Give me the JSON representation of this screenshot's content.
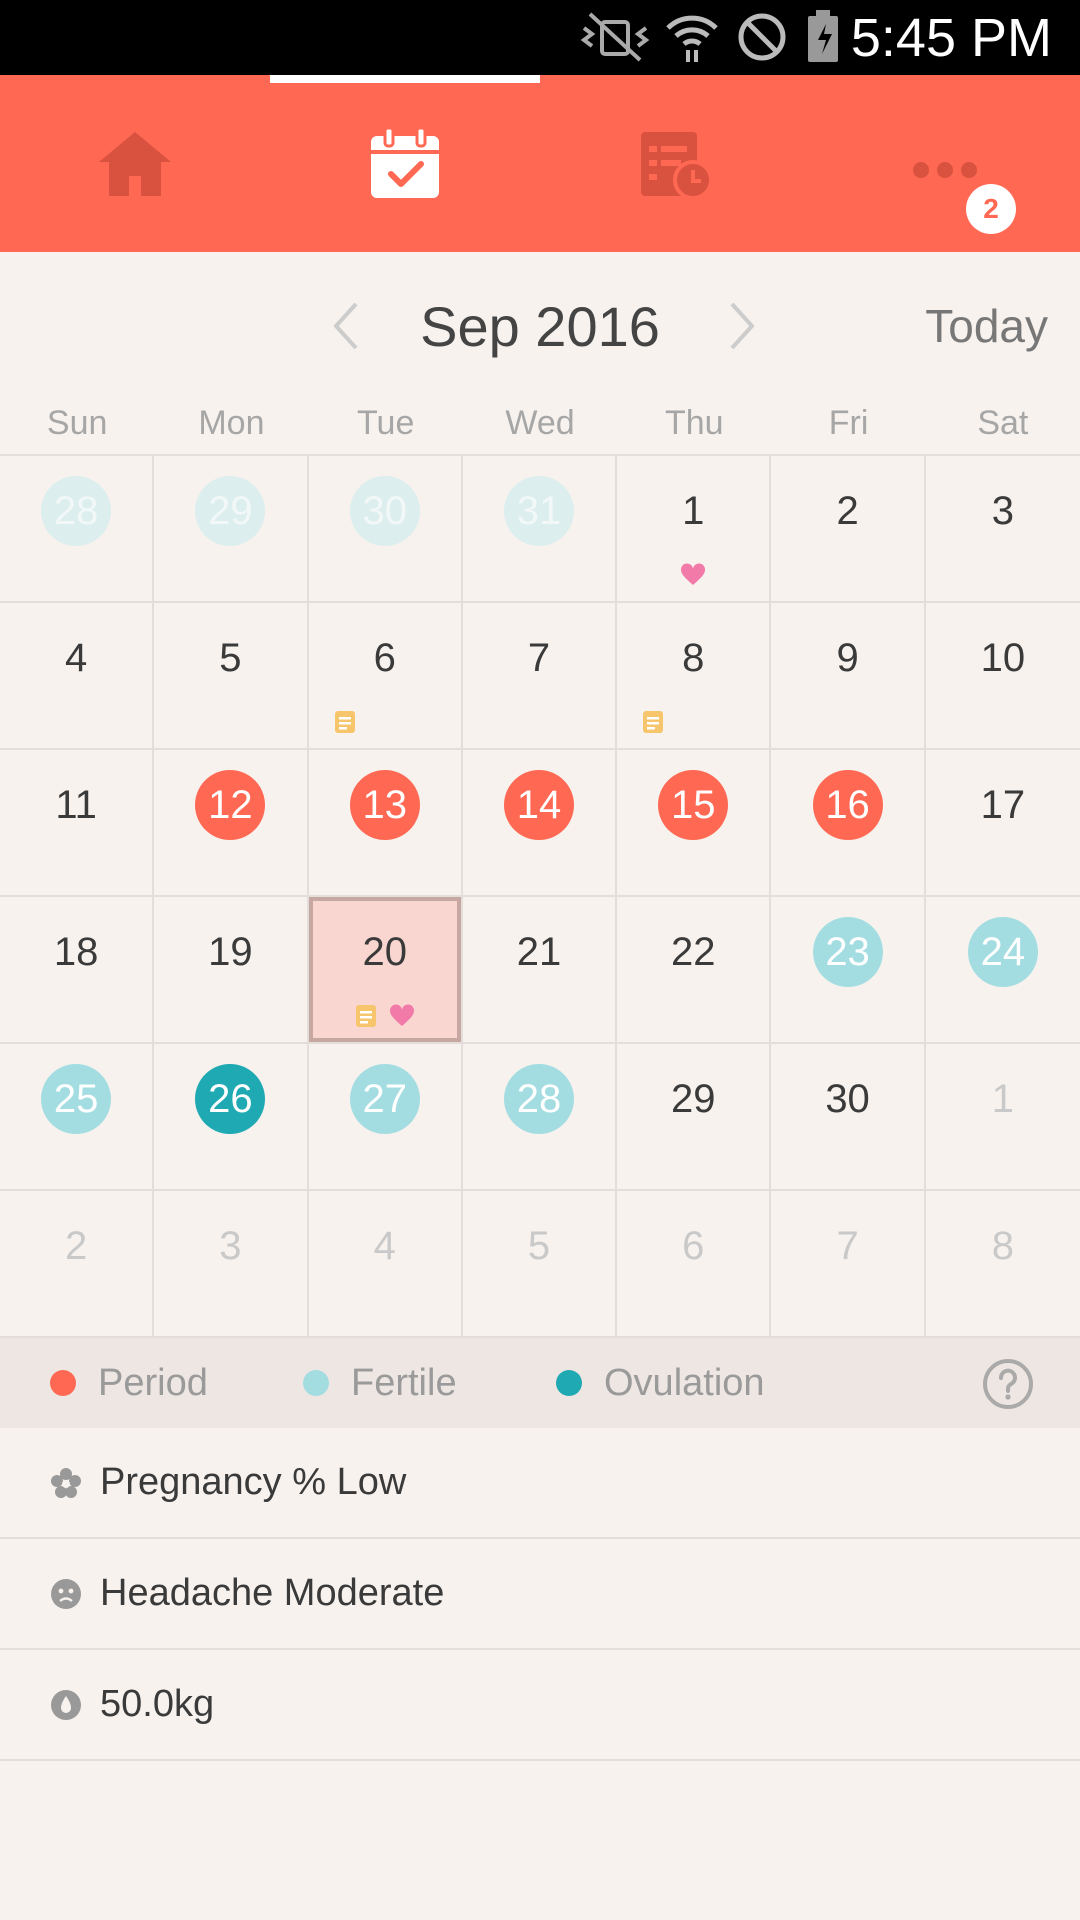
{
  "status_bar": {
    "time": "5:45 PM"
  },
  "nav": {
    "tabs": [
      {
        "name": "home",
        "active": false
      },
      {
        "name": "calendar",
        "active": true
      },
      {
        "name": "history",
        "active": false
      },
      {
        "name": "more",
        "active": false
      }
    ],
    "more_badge": "2"
  },
  "month_header": {
    "title": "Sep 2016",
    "today_label": "Today"
  },
  "weekdays": [
    "Sun",
    "Mon",
    "Tue",
    "Wed",
    "Thu",
    "Fri",
    "Sat"
  ],
  "calendar": {
    "days": [
      {
        "d": "28",
        "muted": true,
        "type": "fertile"
      },
      {
        "d": "29",
        "muted": true,
        "type": "fertile"
      },
      {
        "d": "30",
        "muted": true,
        "type": "fertile"
      },
      {
        "d": "31",
        "muted": true,
        "type": "fertile"
      },
      {
        "d": "1",
        "marks": [
          "heart"
        ]
      },
      {
        "d": "2"
      },
      {
        "d": "3"
      },
      {
        "d": "4"
      },
      {
        "d": "5"
      },
      {
        "d": "6",
        "marks": [
          "note"
        ]
      },
      {
        "d": "7"
      },
      {
        "d": "8",
        "marks": [
          "note"
        ]
      },
      {
        "d": "9"
      },
      {
        "d": "10"
      },
      {
        "d": "11"
      },
      {
        "d": "12",
        "type": "period"
      },
      {
        "d": "13",
        "type": "period"
      },
      {
        "d": "14",
        "type": "period"
      },
      {
        "d": "15",
        "type": "period"
      },
      {
        "d": "16",
        "type": "period"
      },
      {
        "d": "17"
      },
      {
        "d": "18"
      },
      {
        "d": "19"
      },
      {
        "d": "20",
        "selected": true,
        "marks": [
          "note",
          "heart"
        ]
      },
      {
        "d": "21"
      },
      {
        "d": "22"
      },
      {
        "d": "23",
        "type": "fertile"
      },
      {
        "d": "24",
        "type": "fertile"
      },
      {
        "d": "25",
        "type": "fertile"
      },
      {
        "d": "26",
        "type": "ovulation"
      },
      {
        "d": "27",
        "type": "fertile"
      },
      {
        "d": "28",
        "type": "fertile"
      },
      {
        "d": "29"
      },
      {
        "d": "30"
      },
      {
        "d": "1",
        "muted": true
      },
      {
        "d": "2",
        "muted": true
      },
      {
        "d": "3",
        "muted": true
      },
      {
        "d": "4",
        "muted": true
      },
      {
        "d": "5",
        "muted": true
      },
      {
        "d": "6",
        "muted": true
      },
      {
        "d": "7",
        "muted": true
      },
      {
        "d": "8",
        "muted": true
      }
    ]
  },
  "legend": {
    "period": {
      "label": "Period",
      "color": "#ff6853"
    },
    "fertile": {
      "label": "Fertile",
      "color": "#a3dde2"
    },
    "ovulation": {
      "label": "Ovulation",
      "color": "#1fa9b3"
    }
  },
  "info": {
    "rows": [
      {
        "icon": "flower-icon",
        "text": "Pregnancy % Low"
      },
      {
        "icon": "face-icon",
        "text": "Headache Moderate"
      },
      {
        "icon": "weight-drop-icon",
        "text": "50.0kg"
      }
    ]
  },
  "colors": {
    "accent": "#ff6853",
    "background": "#f7f2ee",
    "selected_day": "#f9d6d0"
  }
}
